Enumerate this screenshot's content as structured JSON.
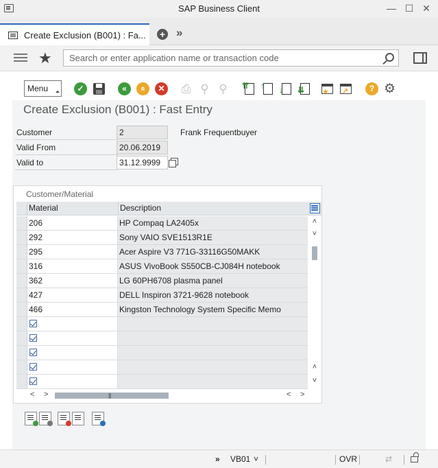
{
  "window": {
    "title": "SAP Business Client",
    "minimize_glyph": "—",
    "maximize_glyph": "☐",
    "close_glyph": "✕"
  },
  "tabs": {
    "active_label": "Create Exclusion (B001) : Fa...",
    "add_glyph": "+",
    "more_glyph": "»"
  },
  "search": {
    "placeholder": "Search or enter application name or transaction code",
    "value": "",
    "star_glyph": "★"
  },
  "toolbar": {
    "menu_label": "Menu",
    "enter_glyph": "✓",
    "back_glyph": "«",
    "exit_glyph": "«",
    "cancel_glyph": "✕",
    "print_glyph": "⎙",
    "find_glyph": "⚲",
    "find_next_glyph": "⚲",
    "help_glyph": "?",
    "settings_glyph": "⚙",
    "icon_colors": {
      "green": "#3d9a3d",
      "yellow": "#eba82a",
      "red": "#d33a2c",
      "disabled": "#c5c5c5"
    }
  },
  "screen": {
    "title": "Create Exclusion (B001) : Fast Entry"
  },
  "form": {
    "customer": {
      "label": "Customer",
      "value": "2",
      "name": "Frank Frequentbuyer"
    },
    "valid_from": {
      "label": "Valid From",
      "value": "20.06.2019"
    },
    "valid_to": {
      "label": "Valid to",
      "value": "31.12.9999"
    }
  },
  "table": {
    "title": "Customer/Material",
    "columns": [
      "Material",
      "Description"
    ],
    "rows": [
      {
        "material": "206",
        "description": "HP Compaq LA2405x"
      },
      {
        "material": "292",
        "description": "Sony VAIO SVE1513R1E"
      },
      {
        "material": "295",
        "description": "Acer Aspire V3 771G-33116G50MAKK"
      },
      {
        "material": "316",
        "description": "ASUS VivoBook S550CB-CJ084H notebook"
      },
      {
        "material": "362",
        "description": "LG 60PH6708 plasma panel"
      },
      {
        "material": "427",
        "description": "DELL Inspiron 3721-9628 notebook"
      },
      {
        "material": "466",
        "description": "Kingston Technology System Specific Memo"
      }
    ],
    "empty_rows": 5,
    "scroll_up_glyph": "˄",
    "scroll_down_glyph": "˅",
    "scroll_left_glyph": "<",
    "scroll_right_glyph": ">",
    "grip_glyph": "|||"
  },
  "statusbar": {
    "expand_glyph": "»",
    "system": "VB01",
    "system_menu_glyph": "˅",
    "mode": "OVR",
    "transfer_glyph": "⇄"
  }
}
